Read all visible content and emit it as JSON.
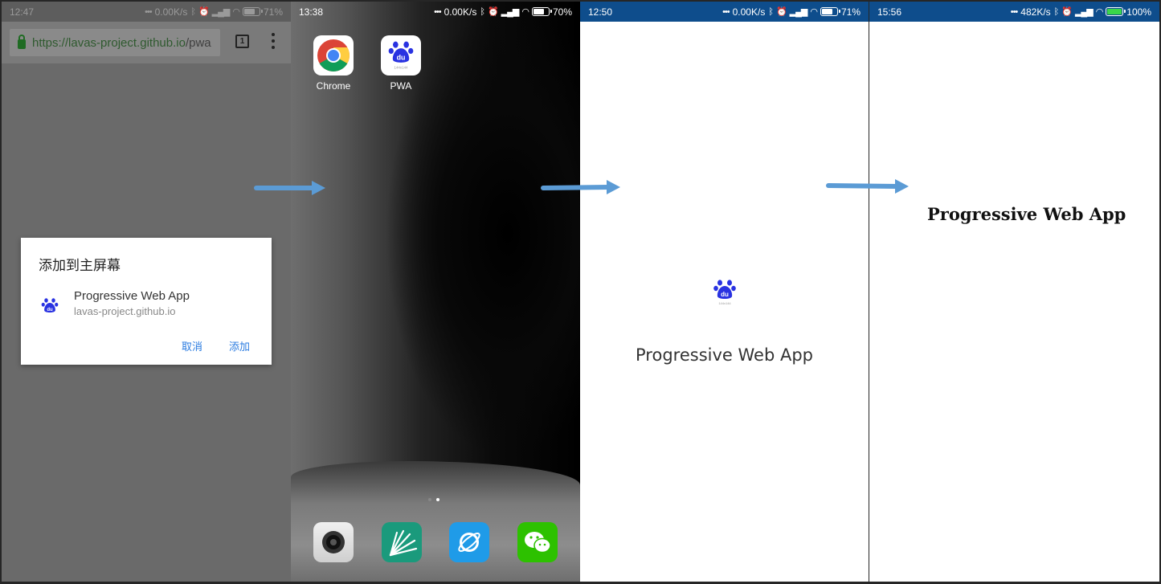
{
  "screens": [
    {
      "status": {
        "time": "12:47",
        "speed": "0.00K/s",
        "battery": "71%"
      },
      "browser": {
        "url_host": "https://lavas-project.github.io",
        "url_path": "/pwa",
        "tab_count": "1"
      },
      "dialog": {
        "title": "添加到主屏幕",
        "app_name": "Progressive Web App",
        "app_url": "lavas-project.github.io",
        "cancel": "取消",
        "add": "添加"
      }
    },
    {
      "status": {
        "time": "13:38",
        "speed": "0.00K/s",
        "battery": "70%"
      },
      "apps": [
        {
          "label": "Chrome",
          "icon": "chrome-icon"
        },
        {
          "label": "PWA",
          "icon": "baidu-paw-icon",
          "badge": "144x144"
        }
      ],
      "dock": [
        "camera-icon",
        "themes-icon",
        "browser-icon",
        "wechat-icon"
      ]
    },
    {
      "status": {
        "time": "12:50",
        "speed": "0.00K/s",
        "battery": "71%"
      },
      "splash": {
        "name": "Progressive Web App",
        "icon": "baidu-paw-icon",
        "badge": "144x144"
      }
    },
    {
      "status": {
        "time": "15:56",
        "speed": "482K/s",
        "battery": "100%"
      },
      "page": {
        "title": "Progressive Web App"
      }
    }
  ],
  "colors": {
    "arrow": "#5b9bd5",
    "status_bar": "#0e4d8c",
    "link": "#2a7be0",
    "baidu_blue": "#2932e1"
  }
}
